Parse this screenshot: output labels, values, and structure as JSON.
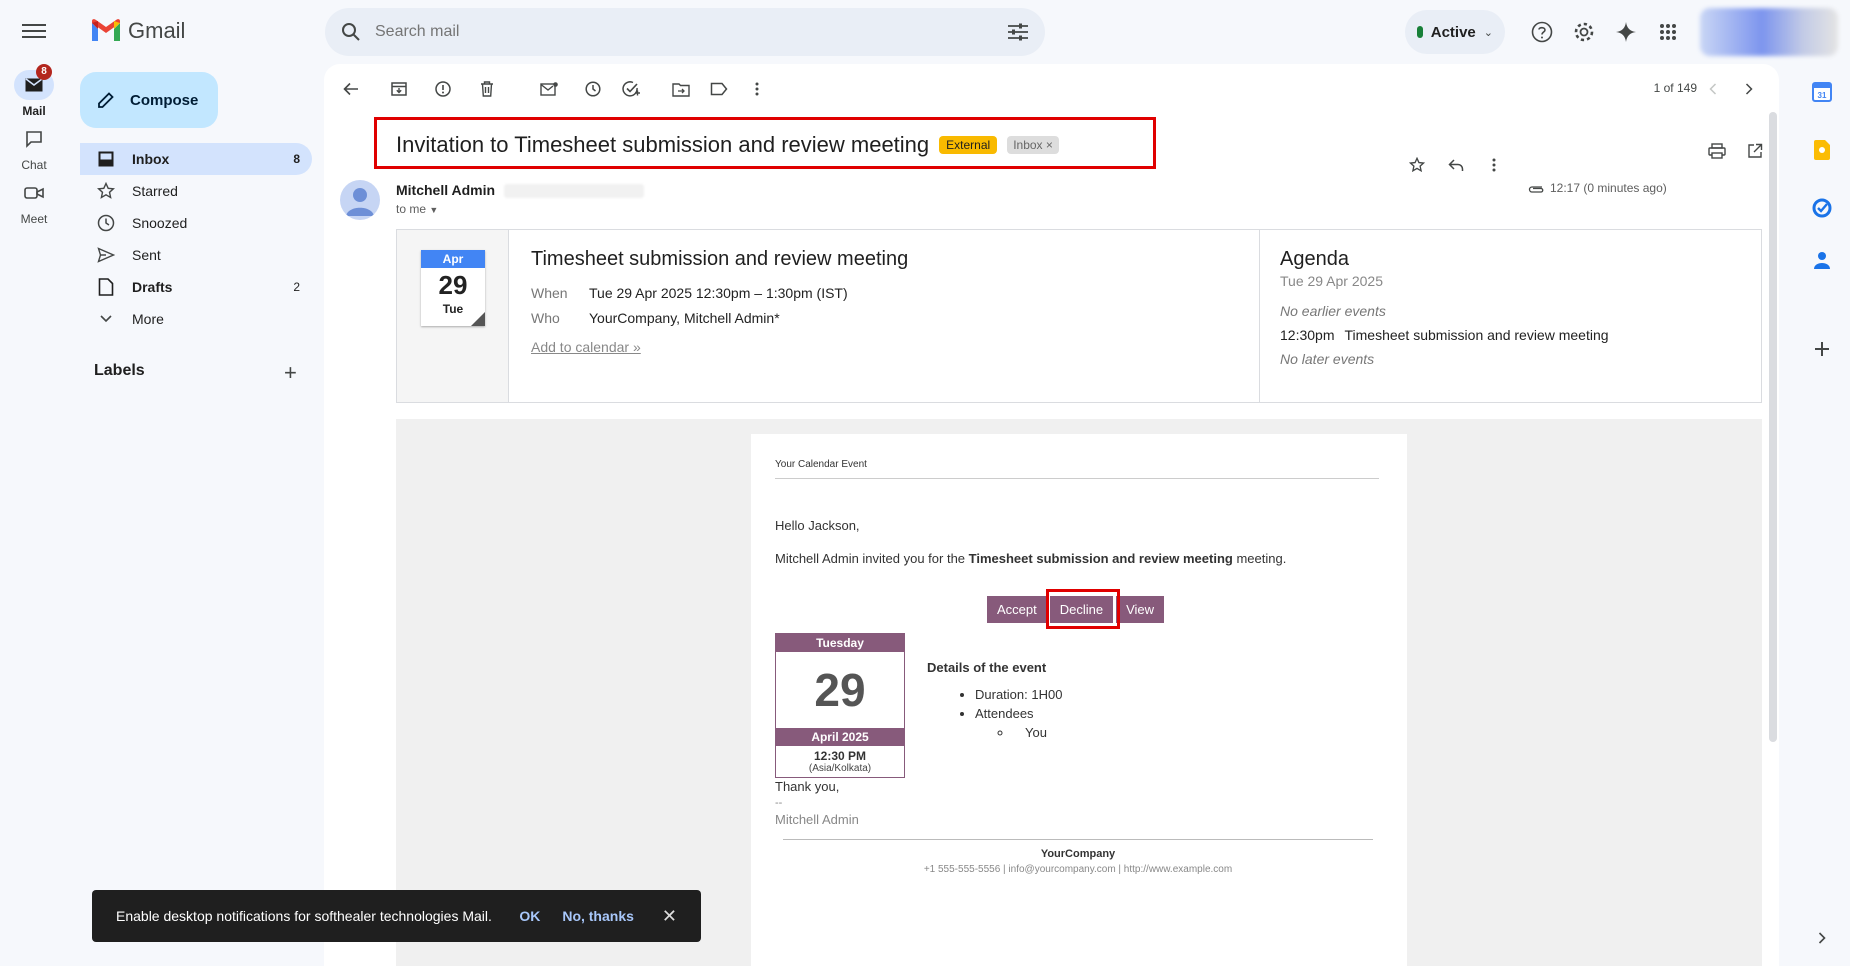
{
  "app": {
    "name": "Gmail"
  },
  "rail": {
    "mail": {
      "label": "Mail",
      "badge": "8"
    },
    "chat": {
      "label": "Chat"
    },
    "meet": {
      "label": "Meet"
    }
  },
  "search": {
    "placeholder": "Search mail"
  },
  "status": {
    "label": "Active"
  },
  "nav": {
    "compose_label": "Compose",
    "items": [
      {
        "label": "Inbox",
        "count": "8"
      },
      {
        "label": "Starred",
        "count": ""
      },
      {
        "label": "Snoozed",
        "count": ""
      },
      {
        "label": "Sent",
        "count": ""
      },
      {
        "label": "Drafts",
        "count": "2"
      },
      {
        "label": "More",
        "count": ""
      }
    ],
    "labels_title": "Labels"
  },
  "toolbar": {
    "pager": "1 of 149"
  },
  "message": {
    "subject": "Invitation to Timesheet submission and review meeting",
    "chip_external": "External",
    "chip_inbox": "Inbox",
    "sender_name": "Mitchell Admin",
    "to": "to me",
    "time": "12:17 (0 minutes ago)"
  },
  "invite": {
    "cal_month": "Apr",
    "cal_day": "29",
    "cal_dow": "Tue",
    "title": "Timesheet submission and review meeting",
    "when_label": "When",
    "when_value": "Tue 29 Apr 2025 12:30pm – 1:30pm (IST)",
    "who_label": "Who",
    "who_value": "YourCompany, Mitchell Admin*",
    "add_to_calendar": "Add to calendar »",
    "agenda_title": "Agenda",
    "agenda_date": "Tue 29 Apr 2025",
    "no_earlier": "No earlier events",
    "event_time": "12:30pm",
    "event_title": "Timesheet submission and review meeting",
    "no_later": "No later events"
  },
  "body": {
    "header": "Your Calendar Event",
    "hello": "Hello Jackson,",
    "invite_prefix": "Mitchell Admin invited you for the ",
    "invite_event": "Timesheet submission and review meeting",
    "invite_suffix": " meeting.",
    "btn_accept": "Accept",
    "btn_decline": "Decline",
    "btn_view": "View",
    "cal_dow": "Tuesday",
    "cal_day": "29",
    "cal_month": "April 2025",
    "cal_time": "12:30 PM",
    "cal_tz": "(Asia/Kolkata)",
    "details_title": "Details of the event",
    "duration": "Duration: 1H00",
    "attendees": "Attendees",
    "attendee_you": "You",
    "thanks": "Thank you,",
    "sig_dash": "--",
    "signature": "Mitchell Admin",
    "company": "YourCompany",
    "contact": "+1 555-555-5556 | info@yourcompany.com | http://www.example.com"
  },
  "toast": {
    "message": "Enable desktop notifications for softhealer technologies Mail.",
    "ok": "OK",
    "no_thanks": "No, thanks"
  }
}
